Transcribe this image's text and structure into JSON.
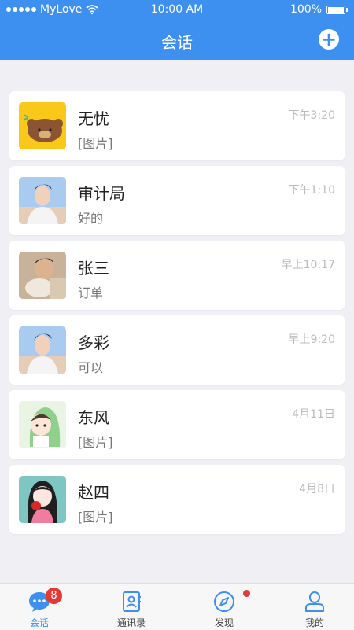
{
  "status_bar": {
    "carrier": "MyLove",
    "time": "10:00 AM",
    "battery": "100%"
  },
  "header": {
    "title": "会话",
    "add_icon": "plus-circle-icon"
  },
  "conversations": [
    {
      "name": "无忧",
      "preview": "[图片]",
      "time": "下午3:20"
    },
    {
      "name": "审计局",
      "preview": "好的",
      "time": "下午1:10"
    },
    {
      "name": "张三",
      "preview": "订单",
      "time": "早上10:17"
    },
    {
      "name": "多彩",
      "preview": "可以",
      "time": "早上9:20"
    },
    {
      "name": "东风",
      "preview": "[图片]",
      "time": "4月11日"
    },
    {
      "name": "赵四",
      "preview": "[图片]",
      "time": "4月8日"
    }
  ],
  "tabbar": {
    "tabs": [
      {
        "label": "会话",
        "icon": "chat-bubble-icon",
        "badge": "8"
      },
      {
        "label": "通讯录",
        "icon": "contacts-book-icon"
      },
      {
        "label": "发现",
        "icon": "compass-icon"
      },
      {
        "label": "我的",
        "icon": "user-profile-icon"
      }
    ]
  },
  "colors": {
    "primary": "#3d8ff0",
    "badge": "#e53935",
    "background": "#efeff4"
  }
}
